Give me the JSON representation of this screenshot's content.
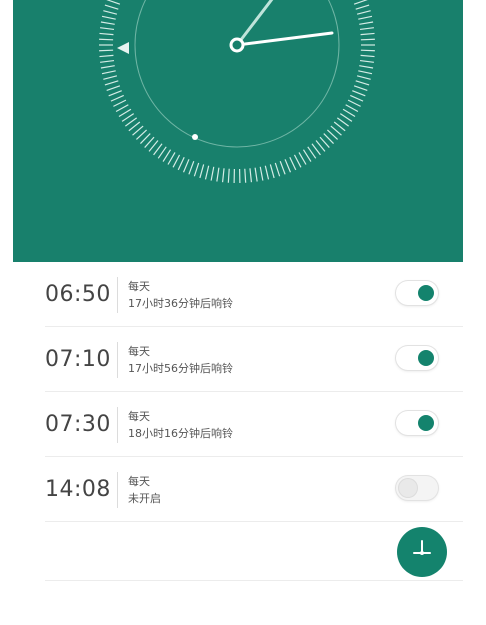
{
  "theme": {
    "accent": "#14836d",
    "header_bg": "#18806c",
    "toggle_off": "#e9e9e9"
  },
  "clock": {
    "hands": "analog-clock"
  },
  "alarms": [
    {
      "time": "06:50",
      "repeat": "每天",
      "status": "17小时36分钟后响铃",
      "enabled": true
    },
    {
      "time": "07:10",
      "repeat": "每天",
      "status": "17小时56分钟后响铃",
      "enabled": true
    },
    {
      "time": "07:30",
      "repeat": "每天",
      "status": "18小时16分钟后响铃",
      "enabled": true
    },
    {
      "time": "14:08",
      "repeat": "每天",
      "status": "未开启",
      "enabled": false
    }
  ],
  "fab": {
    "icon": "add-alarm-icon"
  }
}
